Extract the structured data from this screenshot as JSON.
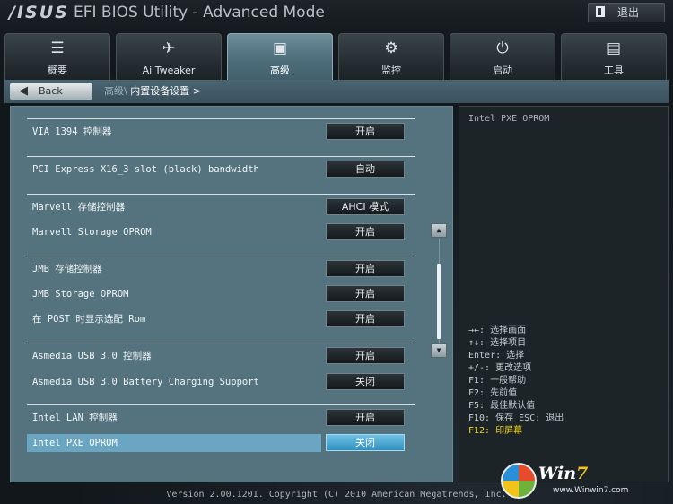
{
  "header": {
    "logo": "/ISUS",
    "title": "EFI BIOS Utility - Advanced Mode",
    "exit_label": "退出"
  },
  "tabs": [
    {
      "label": "概要",
      "icon": "list-icon"
    },
    {
      "label": "Ai Tweaker",
      "icon": "tweaker-icon"
    },
    {
      "label": "高级",
      "icon": "advanced-icon",
      "active": true
    },
    {
      "label": "监控",
      "icon": "monitor-icon"
    },
    {
      "label": "启动",
      "icon": "power-icon"
    },
    {
      "label": "工具",
      "icon": "tool-icon"
    }
  ],
  "breadcrumb": {
    "back_label": "Back",
    "parent": "高级\\",
    "current": "内置设备设置 >"
  },
  "settings": [
    {
      "label": "VIA 1394 控制器",
      "value": "开启"
    },
    {
      "label": "PCI Express X16_3 slot (black) bandwidth",
      "value": "自动"
    },
    {
      "label": "Marvell 存储控制器",
      "value": "AHCI 模式"
    },
    {
      "label": "Marvell Storage OPROM",
      "value": "开启"
    },
    {
      "label": "JMB 存储控制器",
      "value": "开启"
    },
    {
      "label": "JMB Storage OPROM",
      "value": "开启"
    },
    {
      "label": "在 POST 时显示选配 Rom",
      "value": "开启"
    },
    {
      "label": "Asmedia USB 3.0 控制器",
      "value": "开启"
    },
    {
      "label": "Asmedia USB 3.0 Battery Charging Support",
      "value": "关闭"
    },
    {
      "label": "Intel LAN 控制器",
      "value": "开启"
    },
    {
      "label": "Intel PXE OPROM",
      "value": "关闭",
      "selected": true
    }
  ],
  "help": {
    "title": "Intel PXE OPROM",
    "keys": [
      "→←: 选择画面",
      "↑↓: 选择项目",
      "Enter: 选择",
      "+/-: 更改选项",
      "F1: 一般帮助",
      "F2: 先前值",
      "F5: 最佳默认值",
      "F10: 保存  ESC: 退出",
      "F12: 印屏幕"
    ]
  },
  "footer": "Version 2.00.1201. Copyright (C) 2010 American Megatrends, Inc.",
  "watermark": {
    "brand": "Win",
    "num": "7",
    "site": "www.Winwin7.com"
  },
  "colors": {
    "accent": "#6aa6c2",
    "panel": "#54737f",
    "hotkey": "#f0d420"
  }
}
